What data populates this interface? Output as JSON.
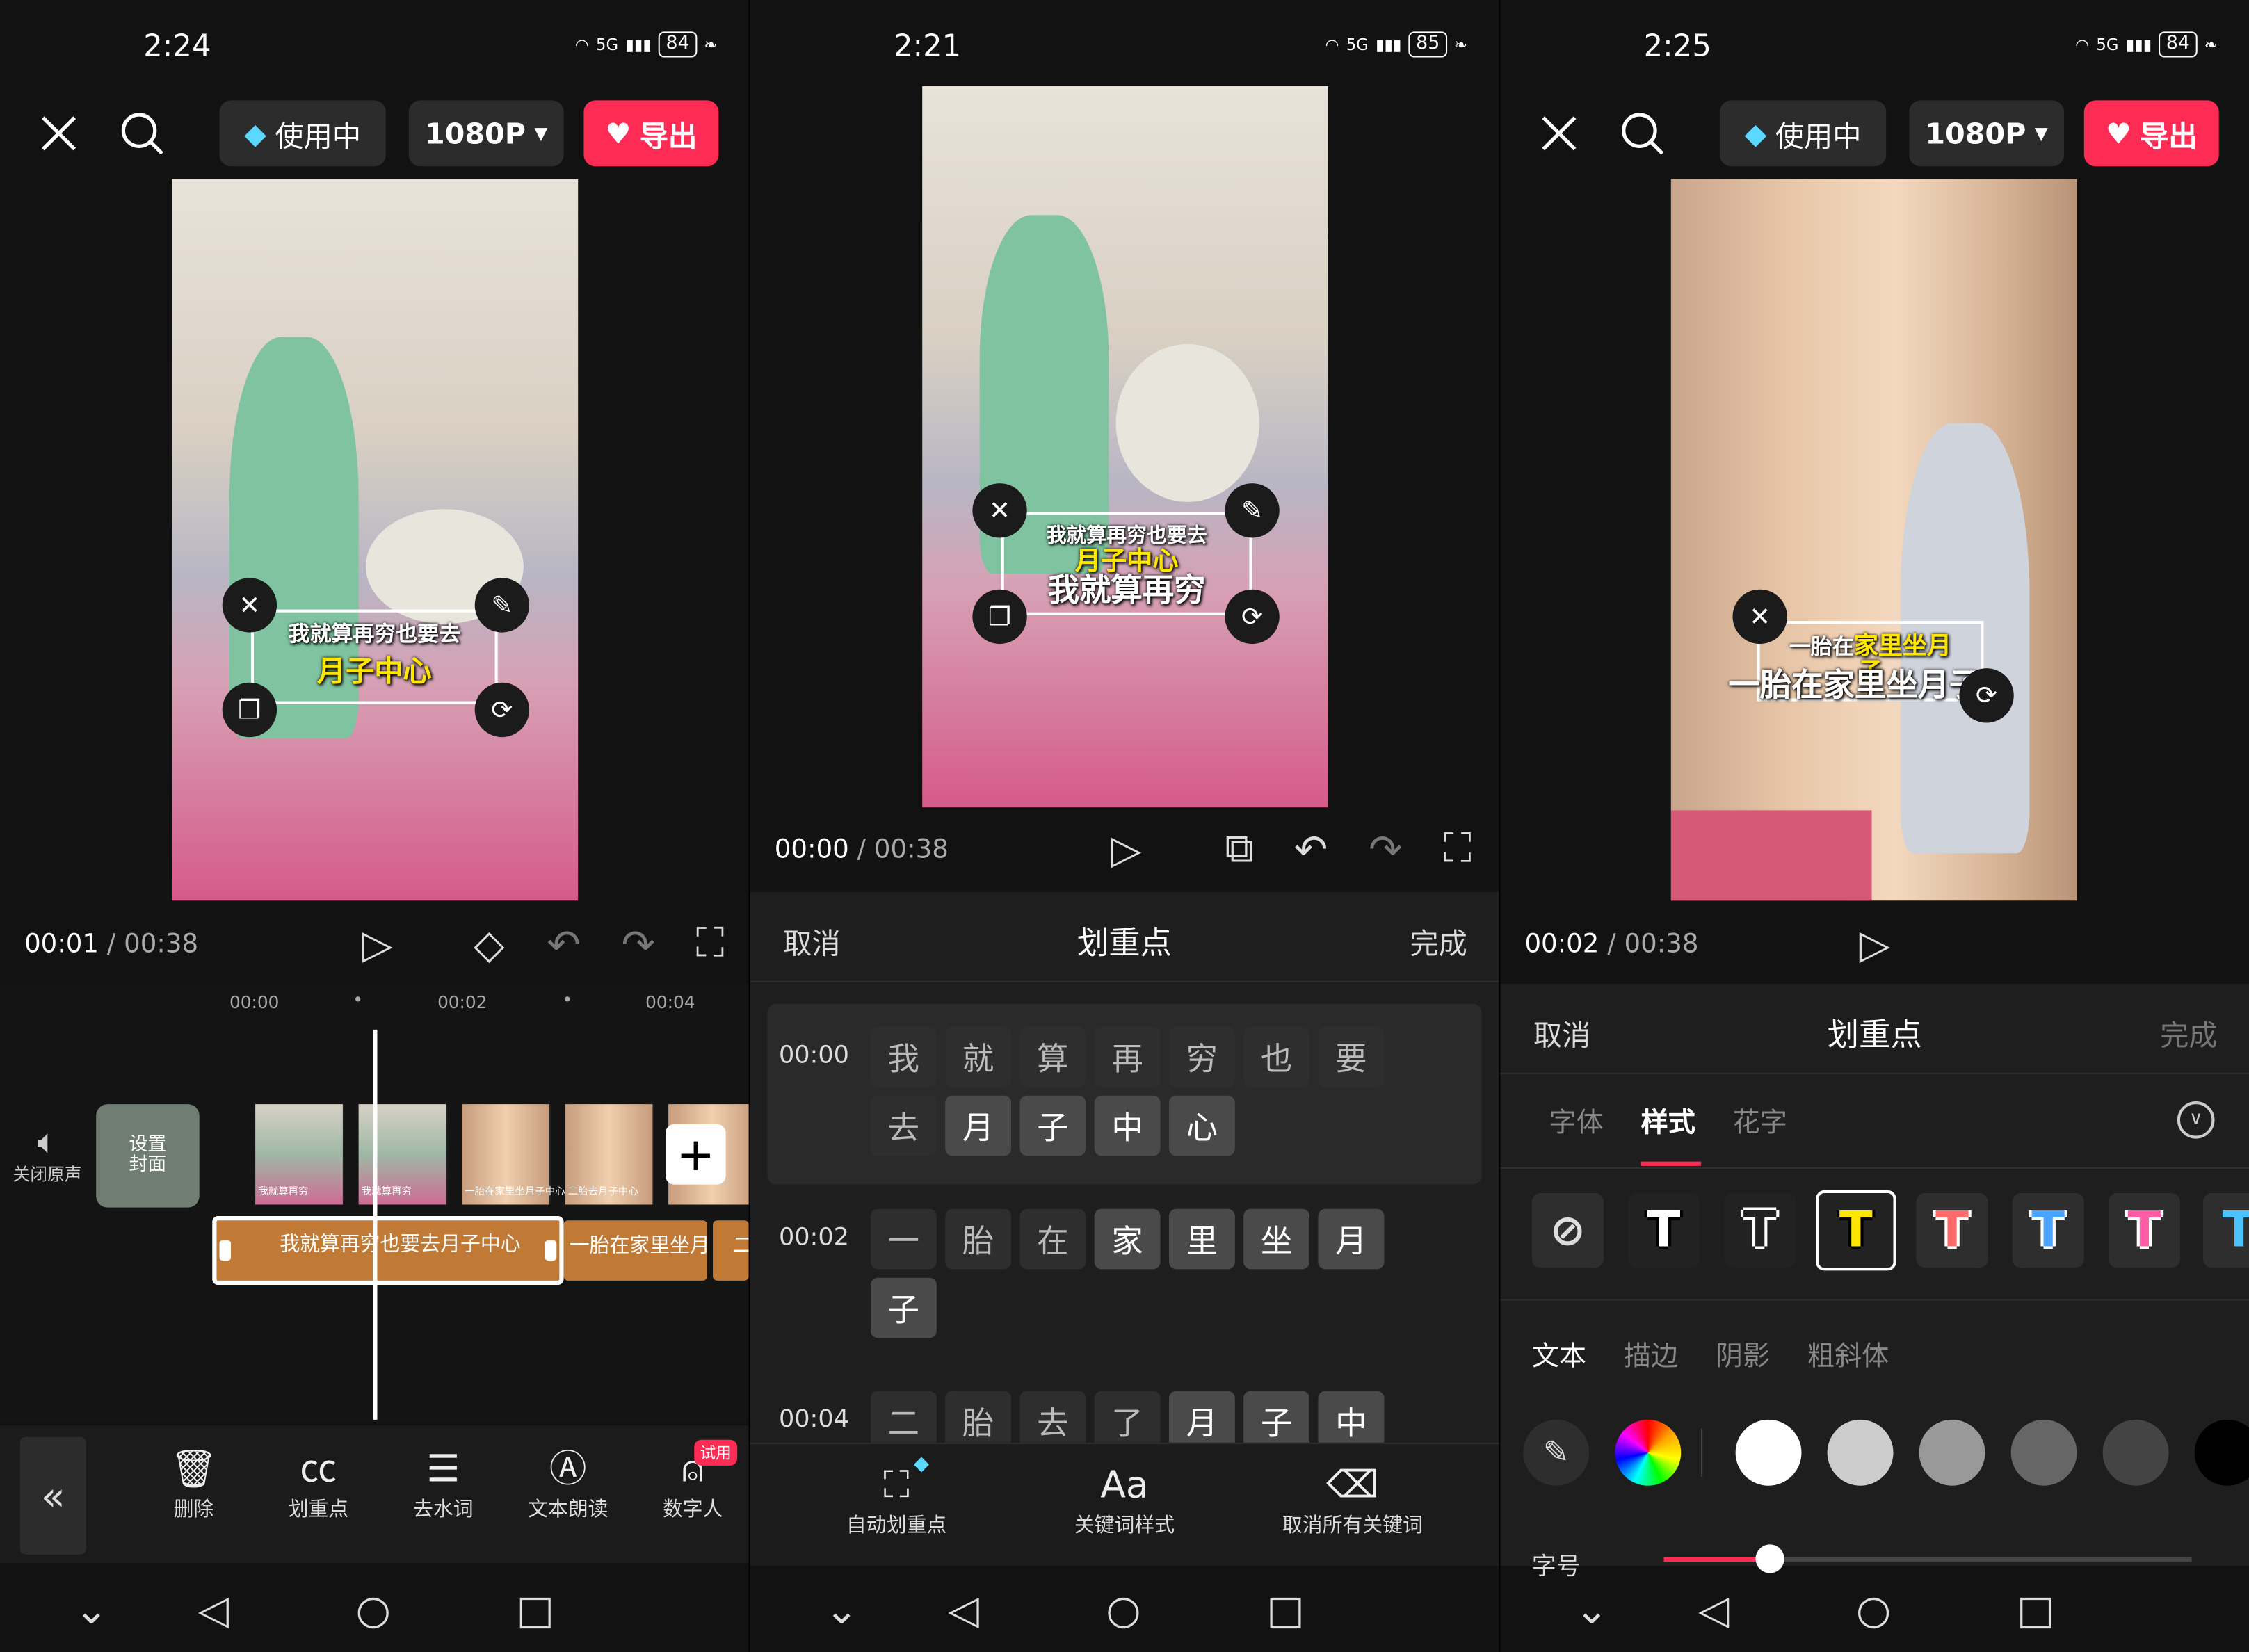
{
  "screens": [
    {
      "status": {
        "time": "2:24",
        "battery": "84",
        "network": "5G"
      },
      "topbar": {
        "vip_label": "使用中",
        "resolution": "1080P",
        "export_label": "导出"
      },
      "caption": {
        "line1": "我就算再穷也要去",
        "line2": "月子中心"
      },
      "player": {
        "current": "00:01",
        "duration": "00:38"
      },
      "ruler": [
        "00:00",
        "00:02",
        "00:04"
      ],
      "timeline": {
        "mute_label": "关闭原声",
        "cover_label": "设置封面",
        "text_clip1": "我就算再穷也要去月子中心",
        "text_clip2": "一胎在家里坐月子",
        "text_clip3": "二"
      },
      "thumb_labels": [
        "我就算再穷",
        "我就算再穷",
        "一胎在家里坐月子中心",
        "二胎去月子中心"
      ],
      "tools": [
        {
          "label": "删除",
          "icon": "trash-icon"
        },
        {
          "label": "划重点",
          "icon": "cc-highlight-icon"
        },
        {
          "label": "去水词",
          "icon": "remove-filler-icon"
        },
        {
          "label": "文本朗读",
          "icon": "text-to-speech-icon"
        },
        {
          "label": "数字人",
          "icon": "digital-human-icon",
          "badge": "试用"
        }
      ]
    },
    {
      "status": {
        "time": "2:21",
        "battery": "85",
        "network": "5G"
      },
      "caption": {
        "line1": "我就算再穷也要去",
        "line2": "月子中心",
        "line3": "我就算再穷"
      },
      "player": {
        "current": "00:00",
        "duration": "00:38"
      },
      "panel": {
        "cancel": "取消",
        "title": "划重点",
        "done": "完成"
      },
      "rows": [
        {
          "time": "00:00",
          "chars": [
            "我",
            "就",
            "算",
            "再",
            "穷",
            "也",
            "要",
            "去",
            "月",
            "子",
            "中",
            "心"
          ],
          "on": [
            8,
            9,
            10,
            11
          ]
        },
        {
          "time": "00:02",
          "chars": [
            "一",
            "胎",
            "在",
            "家",
            "里",
            "坐",
            "月",
            "子"
          ],
          "on": [
            3,
            4,
            5,
            6,
            7
          ]
        },
        {
          "time": "00:04",
          "chars": [
            "二",
            "胎",
            "去",
            "了",
            "月",
            "子",
            "中"
          ],
          "on": [
            4,
            5,
            6
          ]
        }
      ],
      "actions": [
        {
          "label": "自动划重点",
          "icon": "auto-highlight-icon"
        },
        {
          "label": "关键词样式",
          "icon": "keyword-style-icon"
        },
        {
          "label": "取消所有关键词",
          "icon": "eraser-icon"
        }
      ]
    },
    {
      "status": {
        "time": "2:25",
        "battery": "84",
        "network": "5G"
      },
      "topbar": {
        "vip_label": "使用中",
        "resolution": "1080P",
        "export_label": "导出"
      },
      "caption": {
        "w1": "一胎在",
        "y1": "家里坐月",
        "y2": "子",
        "line3": "一胎在家里坐月子"
      },
      "player": {
        "current": "00:02",
        "duration": "00:38"
      },
      "panel": {
        "cancel": "取消",
        "title": "划重点",
        "done": "完成"
      },
      "tabs": [
        "字体",
        "样式",
        "花字"
      ],
      "style_glyph": "T",
      "subtabs": [
        "文本",
        "描边",
        "阴影",
        "粗斜体"
      ],
      "colors": [
        "#ffffff",
        "#cccccc",
        "#999999",
        "#666666",
        "#444444",
        "#000000"
      ],
      "size_label": "字号",
      "size_value": 0.2
    }
  ],
  "accent": "#fe2c55",
  "highlight_yellow": "#ffe600"
}
